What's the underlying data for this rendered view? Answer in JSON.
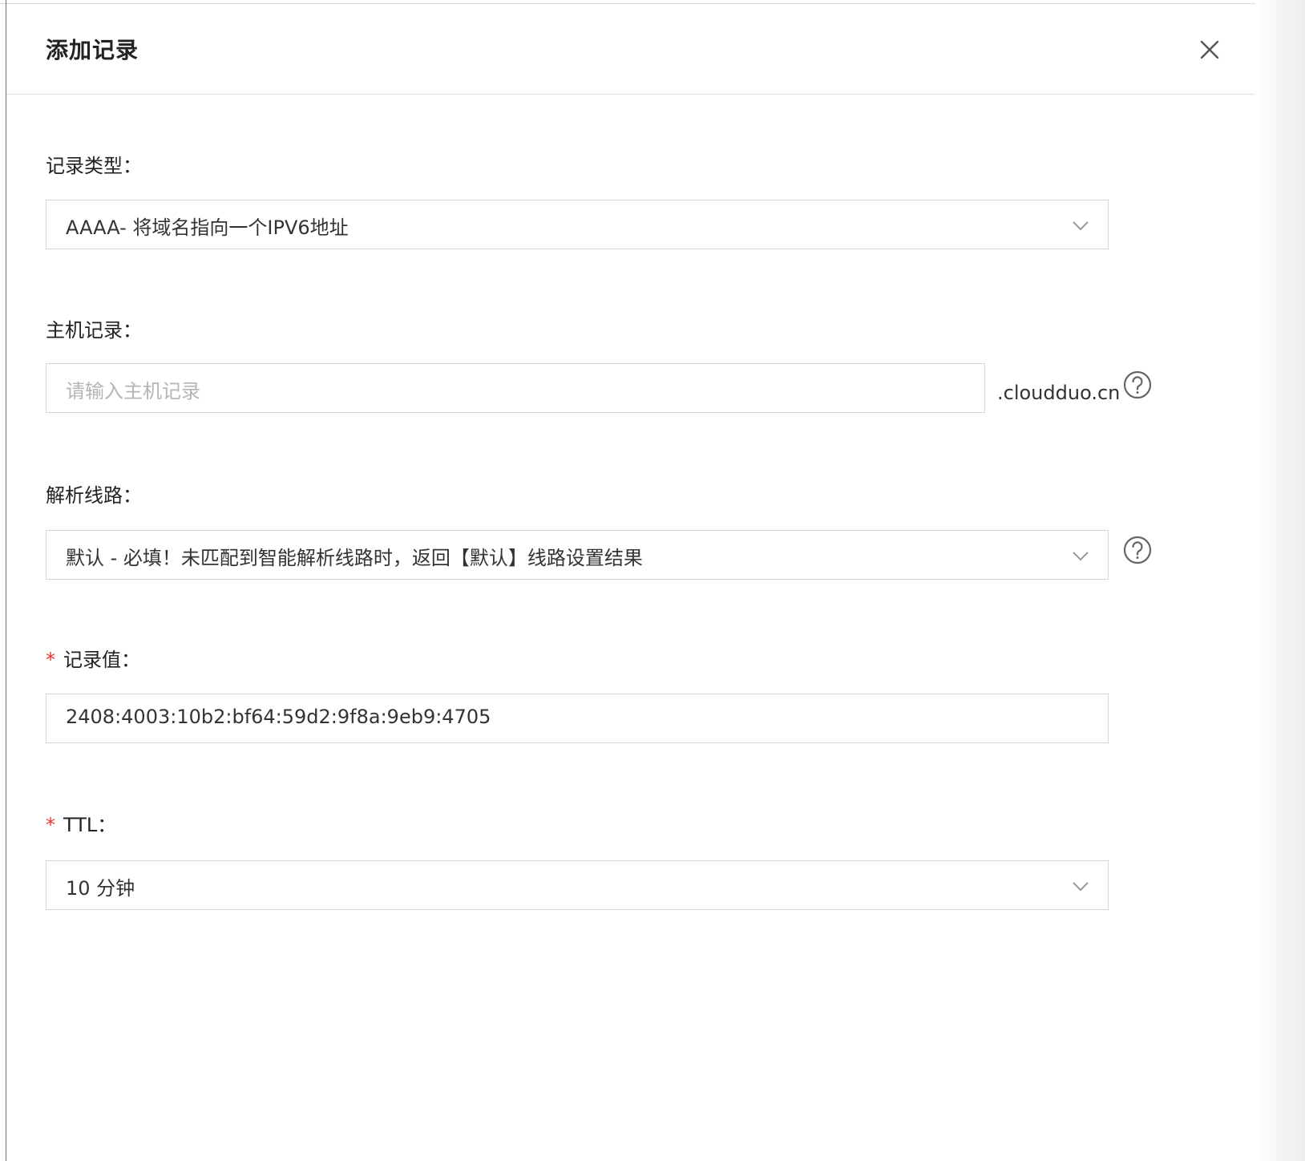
{
  "dialog": {
    "title": "添加记录",
    "close_icon": "close-icon"
  },
  "record_type": {
    "label": "记录类型：",
    "value": "AAAA- 将域名指向一个IPV6地址"
  },
  "host_record": {
    "label": "主机记录：",
    "placeholder": "请输入主机记录",
    "suffix": ".cloudduo.cn",
    "help_icon": "question-circle-icon"
  },
  "resolution_line": {
    "label": "解析线路：",
    "value": "默认 - 必填！未匹配到智能解析线路时，返回【默认】线路设置结果",
    "help_icon": "question-circle-icon"
  },
  "record_value": {
    "required_mark": "*",
    "label": "记录值：",
    "value": "2408:4003:10b2:bf64:59d2:9f8a:9eb9:4705"
  },
  "ttl": {
    "required_mark": "*",
    "label": "TTL：",
    "value": "10 分钟"
  },
  "colors": {
    "required": "#e53935",
    "border": "#d6d6d6",
    "text": "#222222",
    "placeholder": "#b5b5b5"
  }
}
